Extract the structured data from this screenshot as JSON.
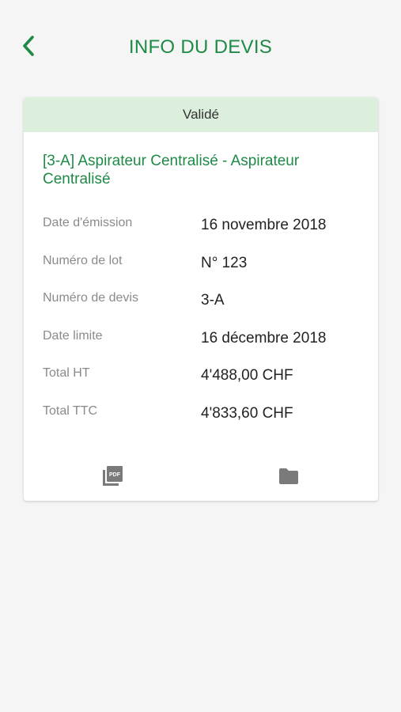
{
  "header": {
    "title": "INFO DU DEVIS",
    "back_icon": "chevron-left-icon",
    "accent_color": "#1e8a45"
  },
  "card": {
    "status": "Validé",
    "status_color": "#dcefdc",
    "title": "[3-A] Aspirateur Centralisé - Aspirateur Centralisé",
    "rows": [
      {
        "label": "Date d'émission",
        "value": "16 novembre 2018"
      },
      {
        "label": "Numéro de lot",
        "value": "N° 123"
      },
      {
        "label": "Numéro de devis",
        "value": "3-A"
      },
      {
        "label": "Date limite",
        "value": "16 décembre 2018"
      },
      {
        "label": "Total HT",
        "value": "4'488,00 CHF"
      },
      {
        "label": "Total TTC",
        "value": "4'833,60 CHF"
      }
    ],
    "actions": [
      {
        "icon": "pdf-icon"
      },
      {
        "icon": "folder-icon"
      }
    ]
  }
}
